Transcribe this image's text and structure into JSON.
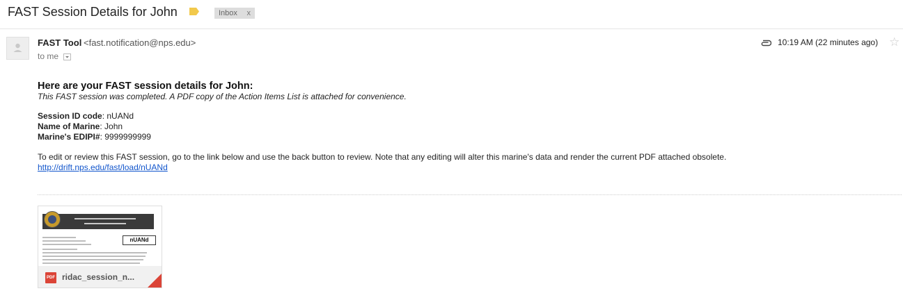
{
  "subject": "FAST Session Details for John",
  "label_chip": {
    "text": "Inbox",
    "close": "x"
  },
  "sender": {
    "name": "FAST Tool",
    "email": "<fast.notification@nps.edu>",
    "to": "to me"
  },
  "timestamp": "10:19 AM (22 minutes ago)",
  "icons": {
    "label": "label-tag-icon",
    "avatar": "default-avatar-icon",
    "attachment": "paperclip-icon",
    "star": "star-outline-icon",
    "toggle": "chevron-down-icon",
    "file": "pdf-icon"
  },
  "body": {
    "heading": "Here are your FAST session details for John:",
    "subline": "This FAST session was completed. A PDF copy of the Action Items List is attached for convenience.",
    "fields": [
      {
        "label": "Session ID code",
        "value": " nUANd"
      },
      {
        "label": "Name of Marine",
        "value": " John"
      },
      {
        "label": "Marine's EDIPI#",
        "value": " 9999999999"
      }
    ],
    "colon": ":",
    "note": "To edit or review this FAST session, go to the link below and use the back button to review. Note that any editing will alter this marine's data and render the current PDF attached obsolete.",
    "link": "http://drift.nps.edu/fast/load/nUANd"
  },
  "attachment": {
    "file_type": "PDF",
    "filename": "ridac_session_n...",
    "thumbnail_code": "nUANd"
  },
  "colors": {
    "link": "#1155cc",
    "label_tag": "#f2c94c",
    "pdf_red": "#db4437"
  }
}
